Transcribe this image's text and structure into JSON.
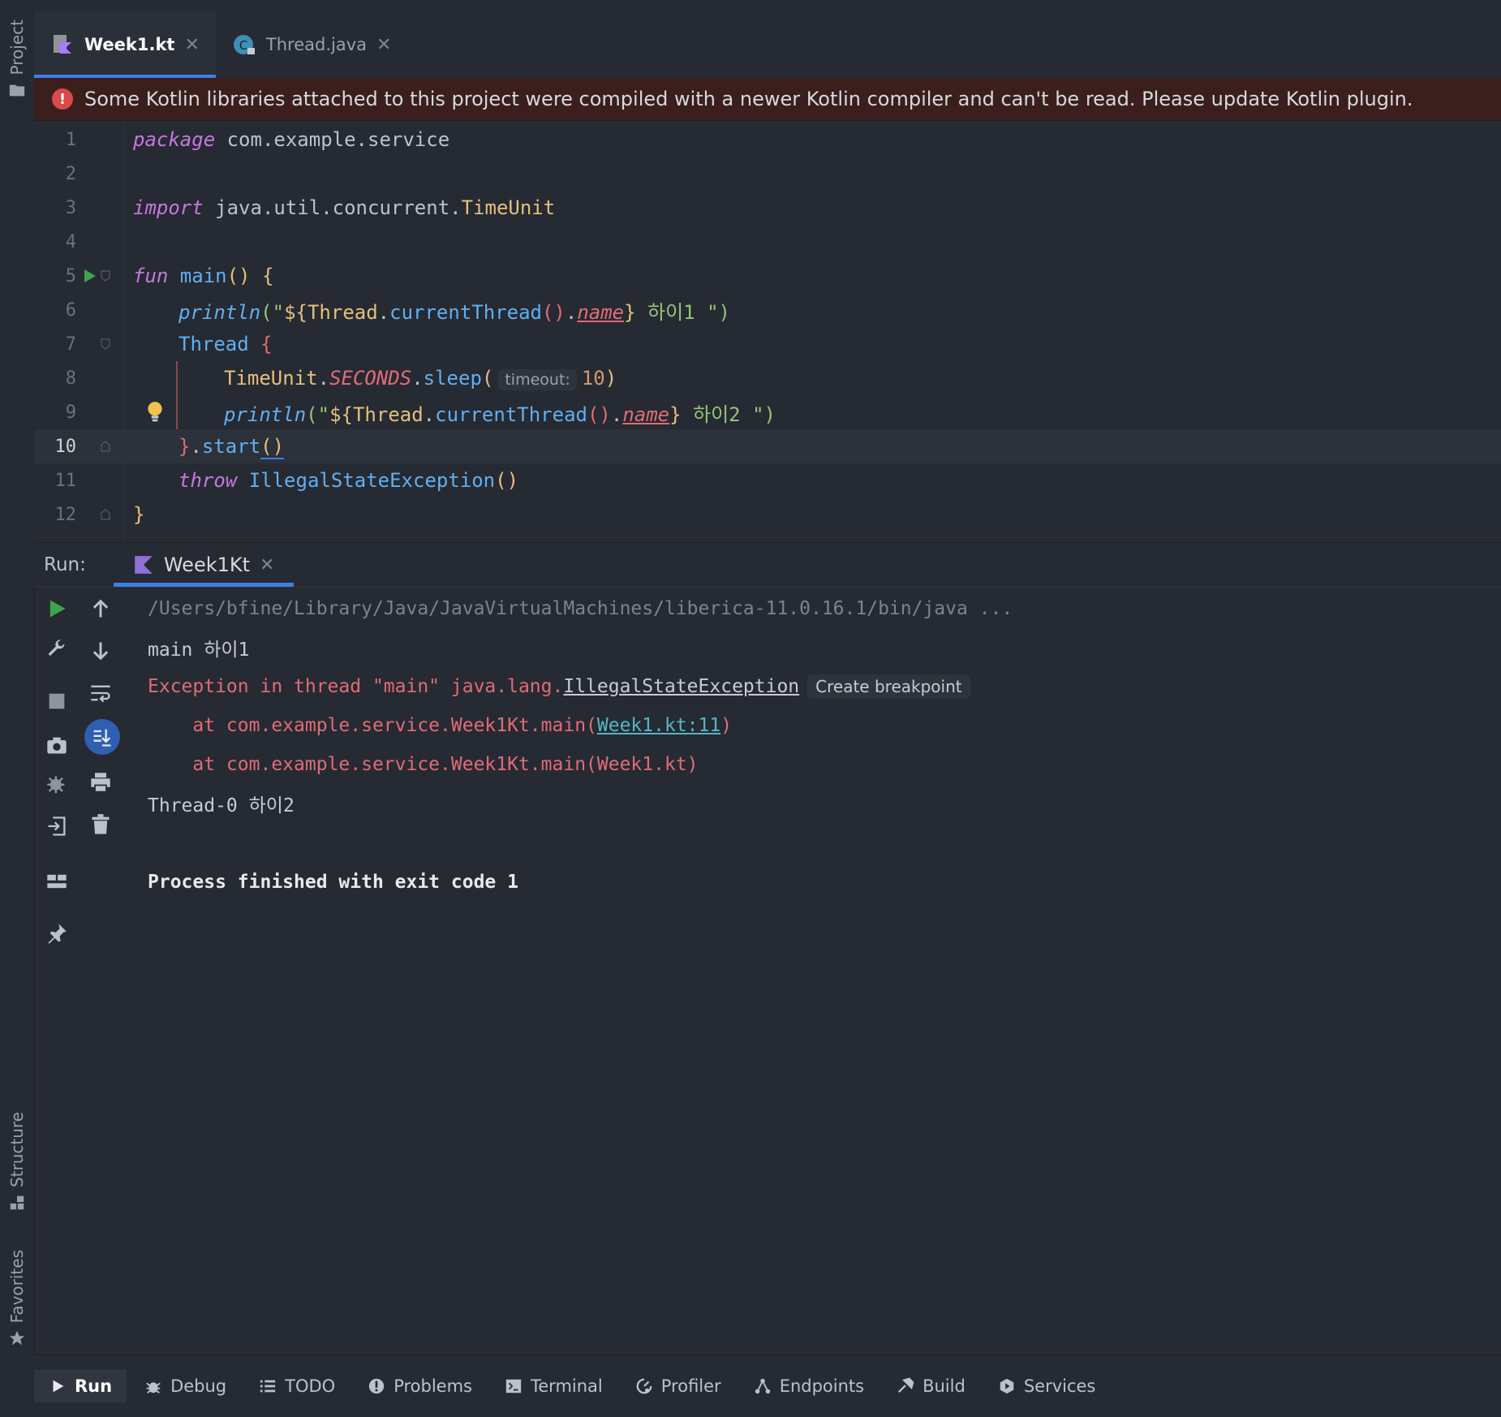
{
  "left_strip": {
    "top_label": "Project",
    "structure_label": "Structure",
    "favorites_label": "Favorites"
  },
  "tabs": [
    {
      "label": "Week1.kt",
      "active": true,
      "icon": "kotlin-file-icon"
    },
    {
      "label": "Thread.java",
      "active": false,
      "icon": "java-class-icon"
    }
  ],
  "banner": {
    "message": "Some Kotlin libraries attached to this project were compiled with a newer Kotlin compiler and can't be read. Please update Kotlin plugin."
  },
  "editor": {
    "line_numbers": [
      "1",
      "2",
      "3",
      "4",
      "5",
      "6",
      "7",
      "8",
      "9",
      "10",
      "11",
      "12"
    ],
    "current_line": "10",
    "tokens": {
      "l1_kw": "package",
      "l1_rest": " com.example.service",
      "l3_kw": "import",
      "l3_rest": " java.util.concurrent.",
      "l3_cls": "TimeUnit",
      "l5_kw": "fun",
      "l5_fn": " main",
      "l5_paren": "()",
      "l5_brace": " {",
      "l6_fn": "println",
      "l6_a": "(\"",
      "l6_b": "${",
      "l6_c": "Thread",
      "l6_d": ".",
      "l6_e": "currentThread",
      "l6_f": "()",
      "l6_g": ".",
      "l6_h": "name",
      "l6_i": "}",
      "l6_j": " 하이1 ",
      "l6_k": "\")",
      "l7_fn": "Thread",
      "l7_brace": " {",
      "l8_cls": "TimeUnit",
      "l8_dot": ".",
      "l8_konst": "SECONDS",
      "l8_dot2": ".",
      "l8_fn": "sleep",
      "l8_open": "(",
      "l8_hint": "timeout:",
      "l8_num": "10",
      "l8_close": ")",
      "l9_fn": "println",
      "l9_a": "(\"",
      "l9_b": "${",
      "l9_c": "Thread",
      "l9_d": ".",
      "l9_e": "currentThread",
      "l9_f": "()",
      "l9_g": ".",
      "l9_h": "name",
      "l9_i": "}",
      "l9_j": " 하이2 ",
      "l9_k": "\")",
      "l10_brace": "}",
      "l10_dot": ".",
      "l10_fn": "start",
      "l10_paren": "()",
      "l11_kw": "throw",
      "l11_fn": " IllegalStateException",
      "l11_paren": "()",
      "l12_brace": "}"
    }
  },
  "run_panel": {
    "label": "Run:",
    "tab_label": "Week1Kt",
    "console": {
      "cmd": "/Users/bfine/Library/Java/JavaVirtualMachines/liberica-11.0.16.1/bin/java ...",
      "out1": "main 하이1",
      "exc_prefix": "Exception in thread \"main\" java.lang.",
      "exc_class": "IllegalStateException",
      "bp_chip": "Create breakpoint",
      "st1_prefix": "    at com.example.service.Week1Kt.main(",
      "st1_link": "Week1.kt:11",
      "st1_suffix": ")",
      "st2": "    at com.example.service.Week1Kt.main(Week1.kt)",
      "out2": "Thread-0 하이2",
      "finish": "Process finished with exit code 1"
    }
  },
  "bottom_bar": [
    {
      "label": "Run",
      "icon": "run-icon",
      "active": true
    },
    {
      "label": "Debug",
      "icon": "debug-icon",
      "active": false
    },
    {
      "label": "TODO",
      "icon": "todo-icon",
      "active": false
    },
    {
      "label": "Problems",
      "icon": "problems-icon",
      "active": false
    },
    {
      "label": "Terminal",
      "icon": "terminal-icon",
      "active": false
    },
    {
      "label": "Profiler",
      "icon": "profiler-icon",
      "active": false
    },
    {
      "label": "Endpoints",
      "icon": "endpoints-icon",
      "active": false
    },
    {
      "label": "Build",
      "icon": "build-icon",
      "active": false
    },
    {
      "label": "Services",
      "icon": "services-icon",
      "active": false
    }
  ],
  "colors": {
    "background": "#262a33",
    "accent": "#3d7fe6",
    "error_banner": "#3a1f1d",
    "run_green": "#3fa34d"
  }
}
